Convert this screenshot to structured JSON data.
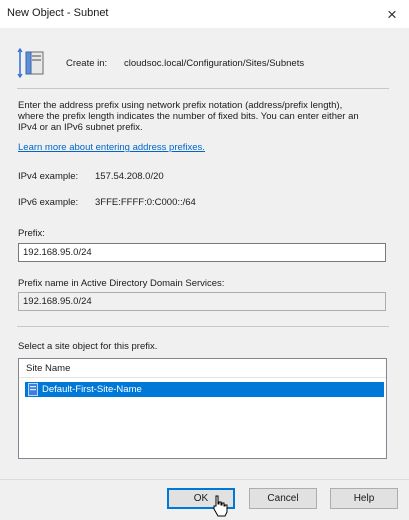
{
  "window": {
    "title": "New Object - Subnet",
    "close_glyph": "×"
  },
  "create_in": {
    "label": "Create in:",
    "path": "cloudsoc.local/Configuration/Sites/Subnets",
    "icon": "ad-container-icon"
  },
  "description": "Enter the address prefix using network prefix notation (address/prefix length), where the prefix length indicates the number of fixed bits. You can enter either an IPv4 or an IPv6 subnet prefix.",
  "link": "Learn more about entering address prefixes.",
  "ipv4": {
    "label": "IPv4 example:",
    "value": "157.54.208.0/20"
  },
  "ipv6": {
    "label": "IPv6 example:",
    "value": "3FFE:FFFF:0:C000::/64"
  },
  "prefix": {
    "label": "Prefix:",
    "value": "192.168.95.0/24"
  },
  "prefix_name": {
    "label": "Prefix name in Active Directory Domain Services:",
    "value": "192.168.95.0/24"
  },
  "site_select": {
    "label": "Select a site object for this prefix.",
    "column_header": "Site Name",
    "items": [
      {
        "name": "Default-First-Site-Name",
        "selected": true,
        "icon": "site-icon"
      }
    ]
  },
  "buttons": {
    "ok": "OK",
    "cancel": "Cancel",
    "help": "Help"
  },
  "colors": {
    "accent": "#0078d7",
    "link": "#0066cc",
    "dialog_bg": "#f0f0f0"
  }
}
